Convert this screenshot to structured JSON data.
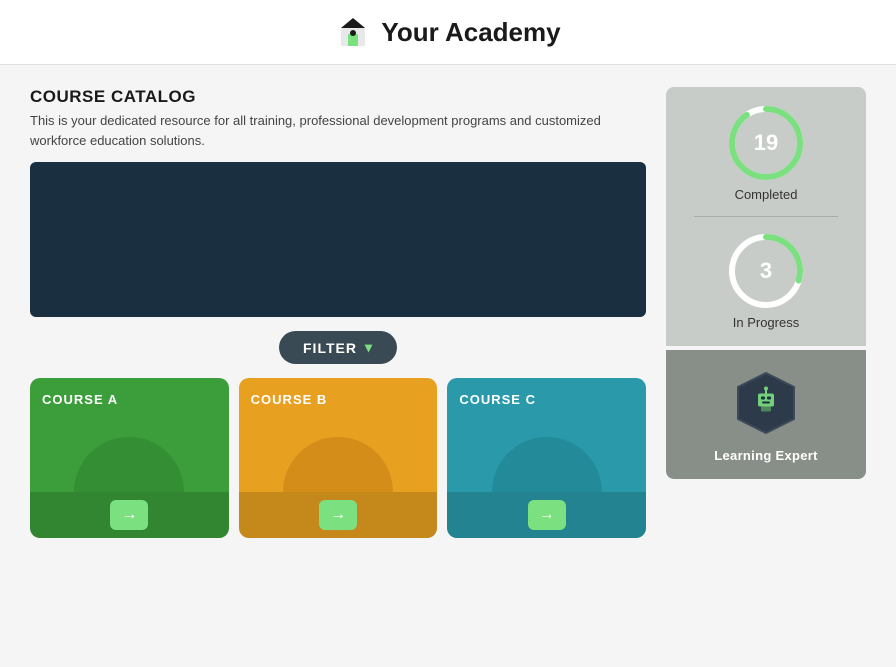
{
  "header": {
    "title": "Your Academy",
    "icon_label": "academy-icon"
  },
  "section": {
    "title": "COURSE CATALOG",
    "description": "This is your dedicated resource for all training, professional development programs and customized workforce education solutions."
  },
  "filter": {
    "label": "FILTER"
  },
  "courses": [
    {
      "id": "a",
      "label": "COURSE A",
      "color": "course-card-a",
      "arc": "arc-a"
    },
    {
      "id": "b",
      "label": "COURSE B",
      "color": "course-card-b",
      "arc": "arc-b"
    },
    {
      "id": "c",
      "label": "COURSE C",
      "color": "course-card-c",
      "arc": "arc-c"
    }
  ],
  "stats": {
    "completed": {
      "number": "19",
      "label": "Completed"
    },
    "in_progress": {
      "number": "3",
      "label": "In Progress"
    }
  },
  "learning_expert": {
    "label": "Learning Expert"
  },
  "arrow": "→"
}
